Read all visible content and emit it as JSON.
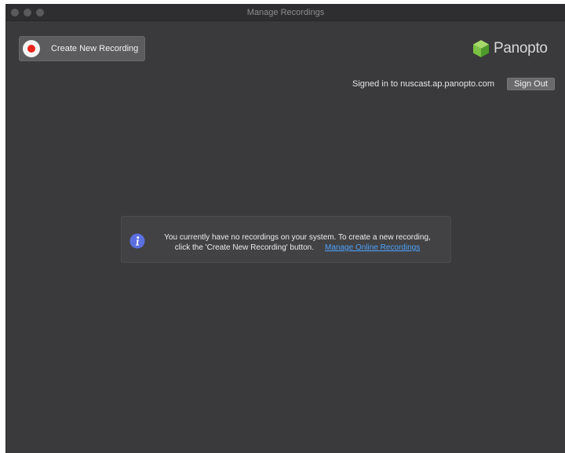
{
  "window": {
    "title": "Manage Recordings"
  },
  "toolbar": {
    "create_label": "Create New Recording"
  },
  "brand": {
    "logo_text": "Panopto",
    "logo_colors": [
      "#7bc143",
      "#4e9a2c",
      "#a6d96a"
    ]
  },
  "account": {
    "signed_in_text": "Signed in to nuscast.ap.panopto.com",
    "sign_out_label": "Sign Out"
  },
  "empty_state": {
    "line1": "You currently have no recordings on your system. To create a new recording,",
    "line2": "click the 'Create New Recording' button.",
    "link_label": "Manage Online Recordings"
  },
  "colors": {
    "record_red": "#e8251c",
    "link_blue": "#4aa3ff",
    "info_icon": "#5b6fe0"
  },
  "icons": {
    "record": "record-icon",
    "info": "info-icon",
    "logo": "panopto-logo-icon"
  }
}
